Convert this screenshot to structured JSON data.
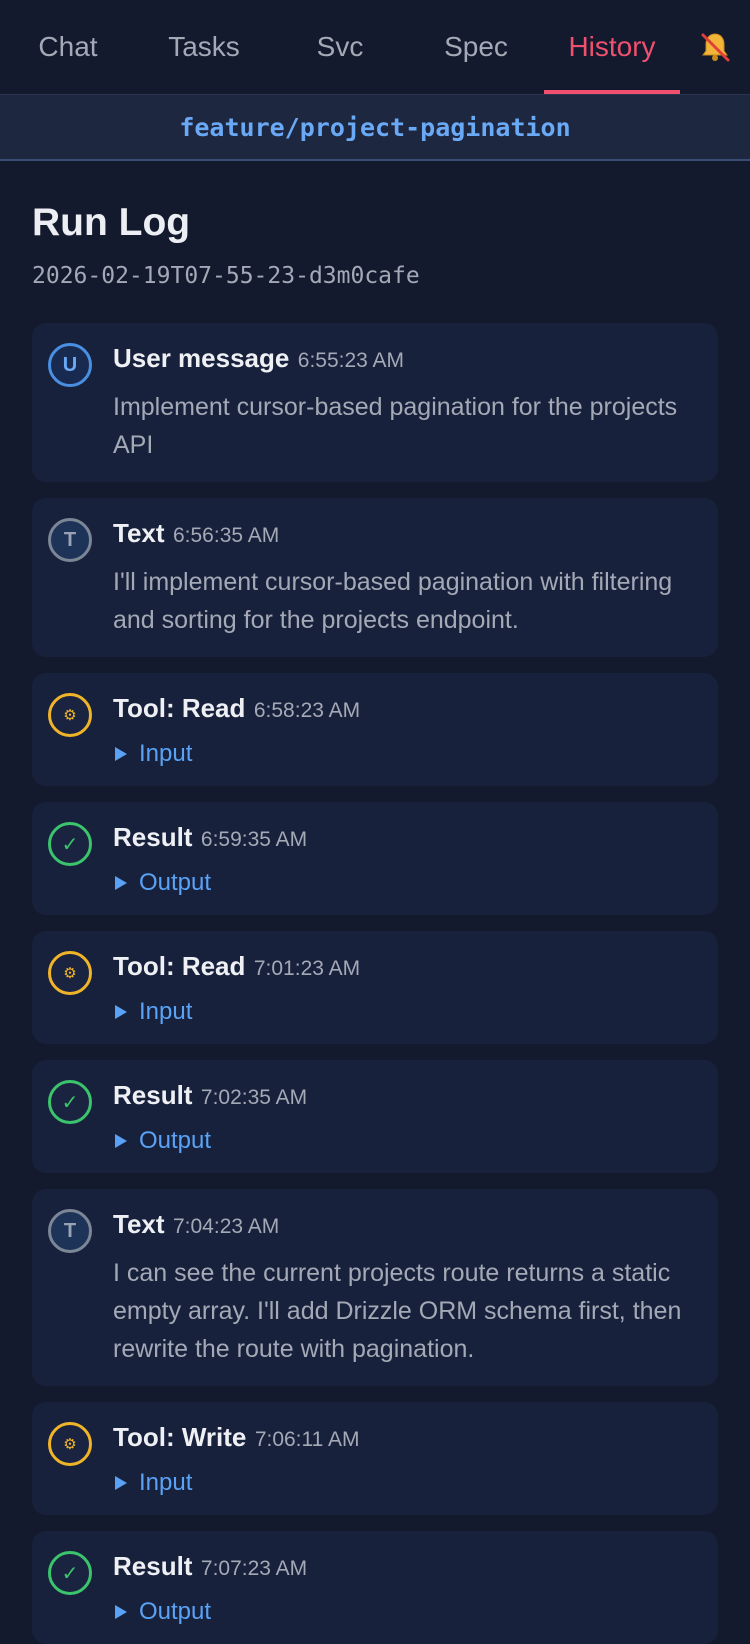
{
  "tabs": [
    {
      "label": "Chat",
      "active": false
    },
    {
      "label": "Tasks",
      "active": false
    },
    {
      "label": "Svc",
      "active": false
    },
    {
      "label": "Spec",
      "active": false
    },
    {
      "label": "History",
      "active": true
    }
  ],
  "notifications_icon": "bell-muted-icon",
  "branch": "feature/project-pagination",
  "page": {
    "title": "Run Log",
    "run_id": "2026-02-19T07-55-23-d3m0cafe"
  },
  "log": [
    {
      "type": "user",
      "badge": "U",
      "label": "User message",
      "time": "6:55:23 AM",
      "message": "Implement cursor-based pagination for the projects API"
    },
    {
      "type": "text",
      "badge": "T",
      "label": "Text",
      "time": "6:56:35 AM",
      "message": "I'll implement cursor-based pagination with filtering and sorting for the projects endpoint."
    },
    {
      "type": "tool",
      "badge": "⚙",
      "label": "Tool: Read",
      "time": "6:58:23 AM",
      "toggle": "Input"
    },
    {
      "type": "result",
      "badge": "✓",
      "label": "Result",
      "time": "6:59:35 AM",
      "toggle": "Output"
    },
    {
      "type": "tool",
      "badge": "⚙",
      "label": "Tool: Read",
      "time": "7:01:23 AM",
      "toggle": "Input"
    },
    {
      "type": "result",
      "badge": "✓",
      "label": "Result",
      "time": "7:02:35 AM",
      "toggle": "Output"
    },
    {
      "type": "text",
      "badge": "T",
      "label": "Text",
      "time": "7:04:23 AM",
      "message": "I can see the current projects route returns a static empty array. I'll add Drizzle ORM schema first, then rewrite the route with pagination."
    },
    {
      "type": "tool",
      "badge": "⚙",
      "label": "Tool: Write",
      "time": "7:06:11 AM",
      "toggle": "Input"
    },
    {
      "type": "result",
      "badge": "✓",
      "label": "Result",
      "time": "7:07:23 AM",
      "toggle": "Output"
    }
  ],
  "colors": {
    "background": "#131a2e",
    "card": "#18213c",
    "accent_active_tab": "#f0506e",
    "link": "#5aa2f5",
    "tool": "#f0b429",
    "result": "#3bc46c",
    "user": "#4a90e2"
  }
}
